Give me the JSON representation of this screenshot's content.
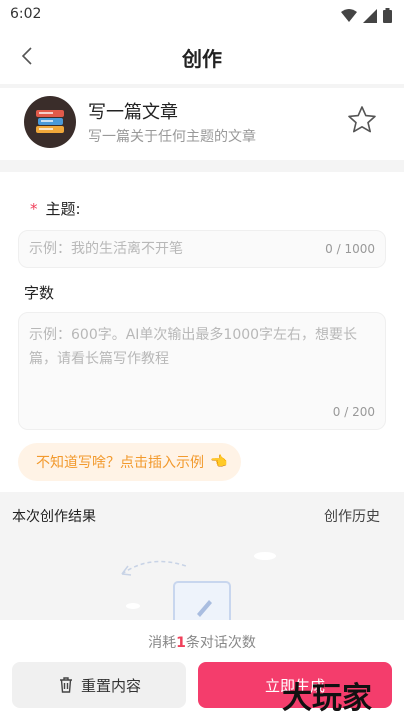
{
  "status": {
    "time": "6:02"
  },
  "nav": {
    "title": "创作"
  },
  "tool": {
    "title": "写一篇文章",
    "subtitle": "写一篇关于任何主题的文章"
  },
  "form": {
    "topic": {
      "required_mark": "*",
      "label": "主题:",
      "placeholder": "示例：我的生活离不开笔",
      "counter": "0 / 1000"
    },
    "wordcount": {
      "label": "字数",
      "placeholder": "示例：600字。AI单次输出最多1000字左右，想要长篇，请看长篇写作教程",
      "counter": "0 / 200"
    },
    "hint": "不知道写啥？点击插入示例"
  },
  "results": {
    "title": "本次创作结果",
    "history": "创作历史"
  },
  "footer": {
    "cost_prefix": "消耗",
    "cost_num": "1",
    "cost_suffix": "条对话次数",
    "reset_label": "重置内容",
    "generate_label": "立即生成"
  },
  "watermark": "大玩家",
  "colors": {
    "accent": "#f43d6c",
    "hint_bg": "#fff3e6",
    "hint_text": "#f29a2e"
  }
}
